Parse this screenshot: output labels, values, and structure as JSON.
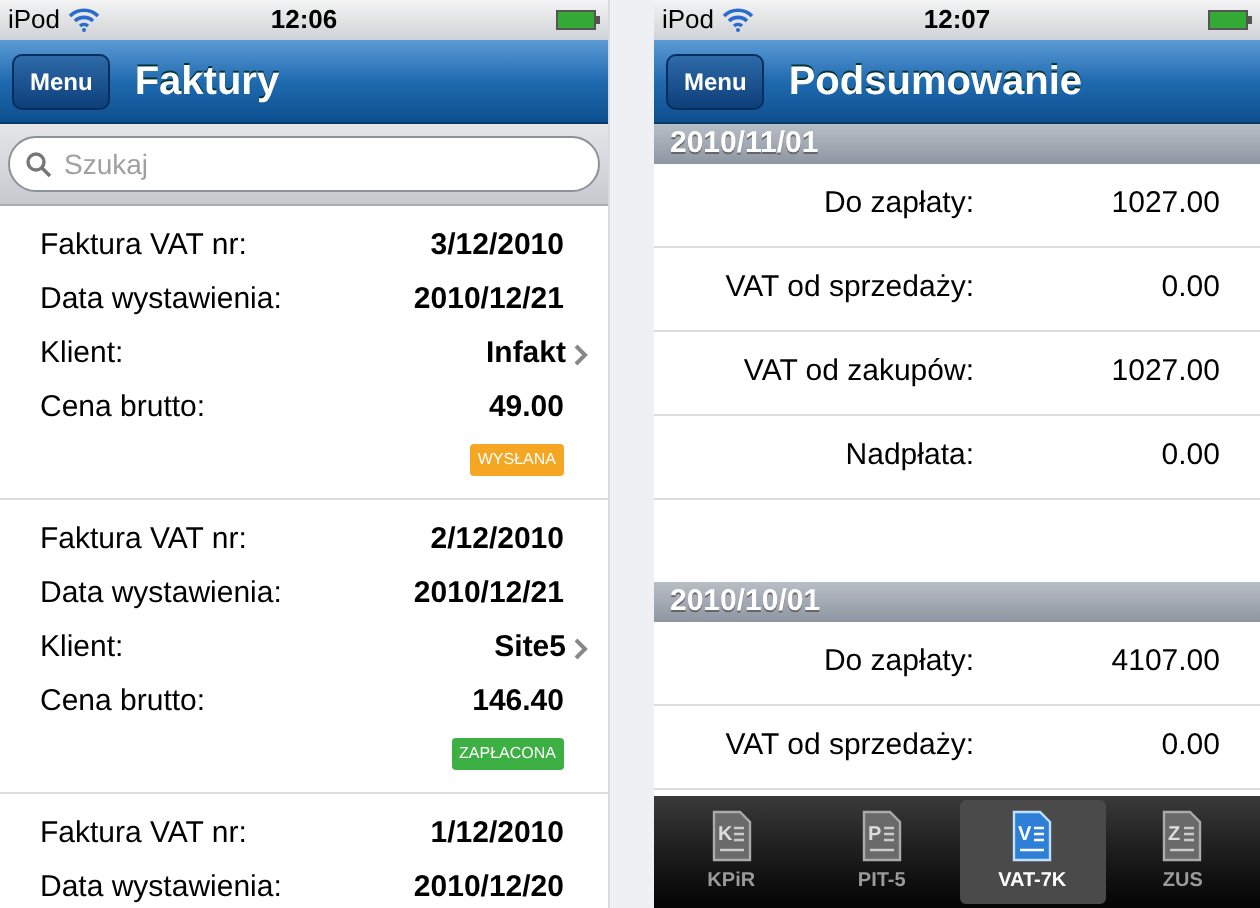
{
  "screens": [
    {
      "status_bar": {
        "carrier": "iPod",
        "time": "12:06"
      },
      "nav": {
        "button": "Menu",
        "title": "Faktury"
      },
      "search": {
        "placeholder": "Szukaj"
      },
      "invoices": [
        {
          "fields": [
            {
              "kind": "text",
              "label": "Faktura VAT nr:",
              "value": "3/12/2010"
            },
            {
              "kind": "text",
              "label": "Data wystawienia:",
              "value": "2010/12/21"
            },
            {
              "kind": "link",
              "label": "Klient:",
              "value": "Infakt"
            },
            {
              "kind": "text",
              "label": "Cena brutto:",
              "value": "49.00"
            }
          ],
          "status": {
            "label": "WYSŁANA",
            "color": "#f5a623"
          }
        },
        {
          "fields": [
            {
              "kind": "text",
              "label": "Faktura VAT nr:",
              "value": "2/12/2010"
            },
            {
              "kind": "text",
              "label": "Data wystawienia:",
              "value": "2010/12/21"
            },
            {
              "kind": "link",
              "label": "Klient:",
              "value": "Site5"
            },
            {
              "kind": "text",
              "label": "Cena brutto:",
              "value": "146.40"
            }
          ],
          "status": {
            "label": "ZAPŁACONA",
            "color": "#3cb043"
          }
        },
        {
          "fields": [
            {
              "kind": "text",
              "label": "Faktura VAT nr:",
              "value": "1/12/2010"
            },
            {
              "kind": "text",
              "label": "Data wystawienia:",
              "value": "2010/12/20"
            }
          ]
        }
      ]
    },
    {
      "status_bar": {
        "carrier": "iPod",
        "time": "12:07"
      },
      "nav": {
        "button": "Menu",
        "title": "Podsumowanie"
      },
      "sections": [
        {
          "date": "2010/11/01",
          "rows": [
            {
              "label": "Do zapłaty:",
              "value": "1027.00"
            },
            {
              "label": "VAT od sprzedaży:",
              "value": "0.00"
            },
            {
              "label": "VAT od zakupów:",
              "value": "1027.00"
            },
            {
              "label": "Nadpłata:",
              "value": "0.00"
            }
          ]
        },
        {
          "date": "2010/10/01",
          "rows": [
            {
              "label": "Do zapłaty:",
              "value": "4107.00"
            },
            {
              "label": "VAT od sprzedaży:",
              "value": "0.00"
            }
          ]
        }
      ],
      "tab_bar": [
        {
          "glyph": "K",
          "label": "KPiR",
          "selected": false
        },
        {
          "glyph": "P",
          "label": "PIT-5",
          "selected": false
        },
        {
          "glyph": "V",
          "label": "VAT-7K",
          "selected": true
        },
        {
          "glyph": "Z",
          "label": "ZUS",
          "selected": false
        }
      ]
    }
  ]
}
